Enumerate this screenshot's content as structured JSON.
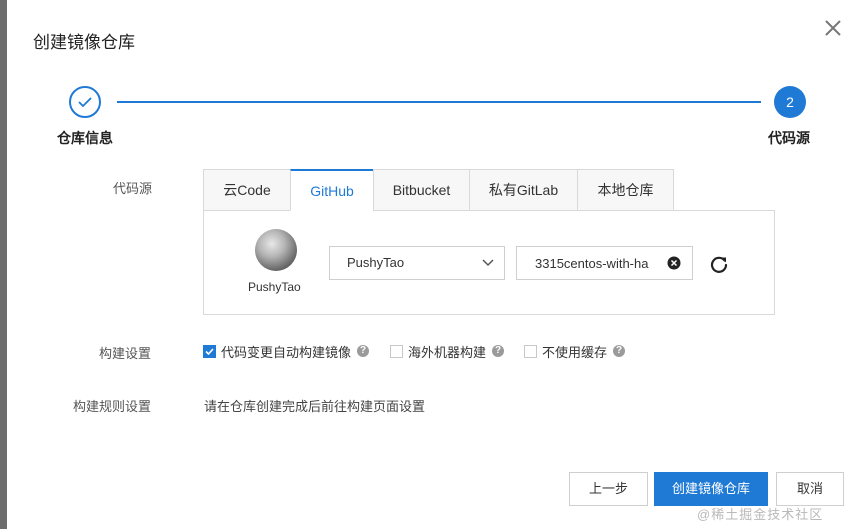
{
  "dialog": {
    "title": "创建镜像仓库"
  },
  "steps": [
    {
      "label": "仓库信息",
      "state": "done"
    },
    {
      "label": "代码源",
      "number": "2",
      "state": "active"
    }
  ],
  "code_source": {
    "label": "代码源",
    "tabs": [
      {
        "label": "云Code",
        "active": false
      },
      {
        "label": "GitHub",
        "active": true
      },
      {
        "label": "Bitbucket",
        "active": false
      },
      {
        "label": "私有GitLab",
        "active": false
      },
      {
        "label": "本地仓库",
        "active": false
      }
    ],
    "account_name": "PushyTao",
    "org_select_value": "PushyTao",
    "repo_value": "3315centos-with-ha"
  },
  "build_settings": {
    "label": "构建设置",
    "options": [
      {
        "label": "代码变更自动构建镜像",
        "checked": true
      },
      {
        "label": "海外机器构建",
        "checked": false
      },
      {
        "label": "不使用缓存",
        "checked": false
      }
    ]
  },
  "build_rules": {
    "label": "构建规则设置",
    "text": "请在仓库创建完成后前往构建页面设置"
  },
  "footer": {
    "prev_label": "上一步",
    "create_label": "创建镜像仓库",
    "cancel_label": "取消"
  },
  "watermark": "@稀土掘金技术社区",
  "colors": {
    "accent": "#1f7ad6",
    "border": "#d9d9d9"
  }
}
